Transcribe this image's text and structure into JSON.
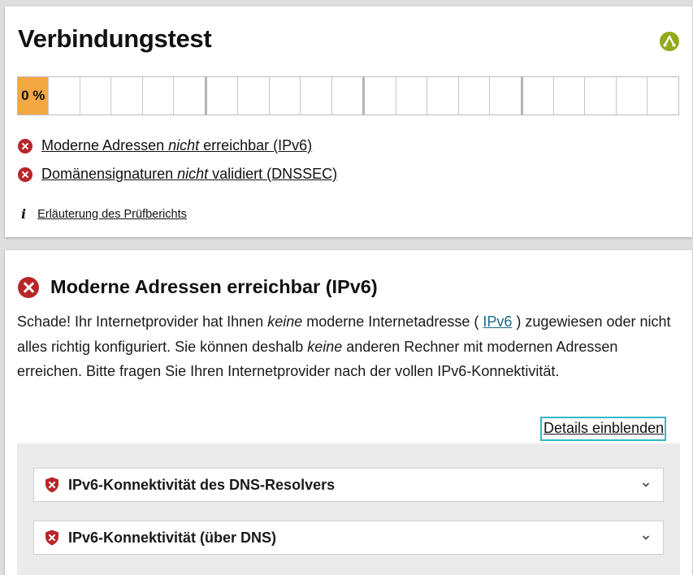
{
  "card1": {
    "title": "Verbindungstest",
    "progress": {
      "label": "0 %",
      "value_percent": 0,
      "segments": 20,
      "accent": "#f5a742"
    },
    "results": [
      {
        "pre": "Moderne Adressen ",
        "em": "nicht",
        "post": " erreichbar (IPv6)"
      },
      {
        "pre": "Domänensignaturen ",
        "em": "nicht",
        "post": " validiert (DNSSEC)"
      }
    ],
    "info_link": "Erläuterung des Prüfberichts",
    "status_color": "#b8262a"
  },
  "card2": {
    "title": "Moderne Adressen erreichbar (IPv6)",
    "desc": {
      "p1": "Schade! Ihr Internetprovider hat Ihnen ",
      "em1": "keine",
      "p2": " moderne Internetadresse ( ",
      "link": "IPv6",
      "p3": " ) zugewiesen oder nicht alles richtig konfiguriert. Sie können deshalb ",
      "em2": "keine",
      "p4": " anderen Rechner mit modernen Adressen erreichen. Bitte fragen Sie Ihren Internetprovider nach der vollen IPv6-Konnektivität."
    },
    "details_button": "Details einblenden",
    "sub_items": [
      {
        "label": "IPv6-Konnektivität des DNS-Resolvers"
      },
      {
        "label": "IPv6-Konnektivität (über DNS)"
      }
    ]
  },
  "icons": {
    "logo": "internet-nl-logo-icon",
    "fail": "x-circle-icon",
    "info": "info-icon",
    "shield": "shield-x-icon",
    "chevron": "chevron-down-icon"
  },
  "colors": {
    "logo_green": "#8faa1b",
    "link_teal": "#1a6b8a",
    "focus_border": "#33b8c9"
  }
}
